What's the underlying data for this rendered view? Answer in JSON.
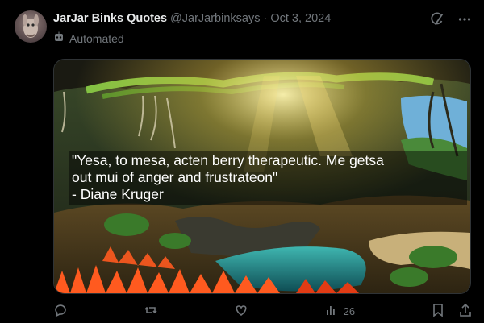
{
  "post": {
    "author_name": "JarJar Binks Quotes",
    "handle": "@JarJarbinksays",
    "separator": "·",
    "date": "Oct 3, 2024",
    "automated_label": "Automated"
  },
  "media": {
    "quote_line1": "\"Yesa, to mesa, acten berry therapeutic. Me getsa",
    "quote_line2": "out mui of anger and frustrateon\"",
    "quote_line3": "- Diane Kruger"
  },
  "actions": {
    "views_count": "26"
  },
  "icons": [
    "grok-icon",
    "more-icon",
    "robot-icon",
    "reply-icon",
    "repost-icon",
    "like-icon",
    "views-icon",
    "bookmark-icon",
    "share-icon"
  ]
}
